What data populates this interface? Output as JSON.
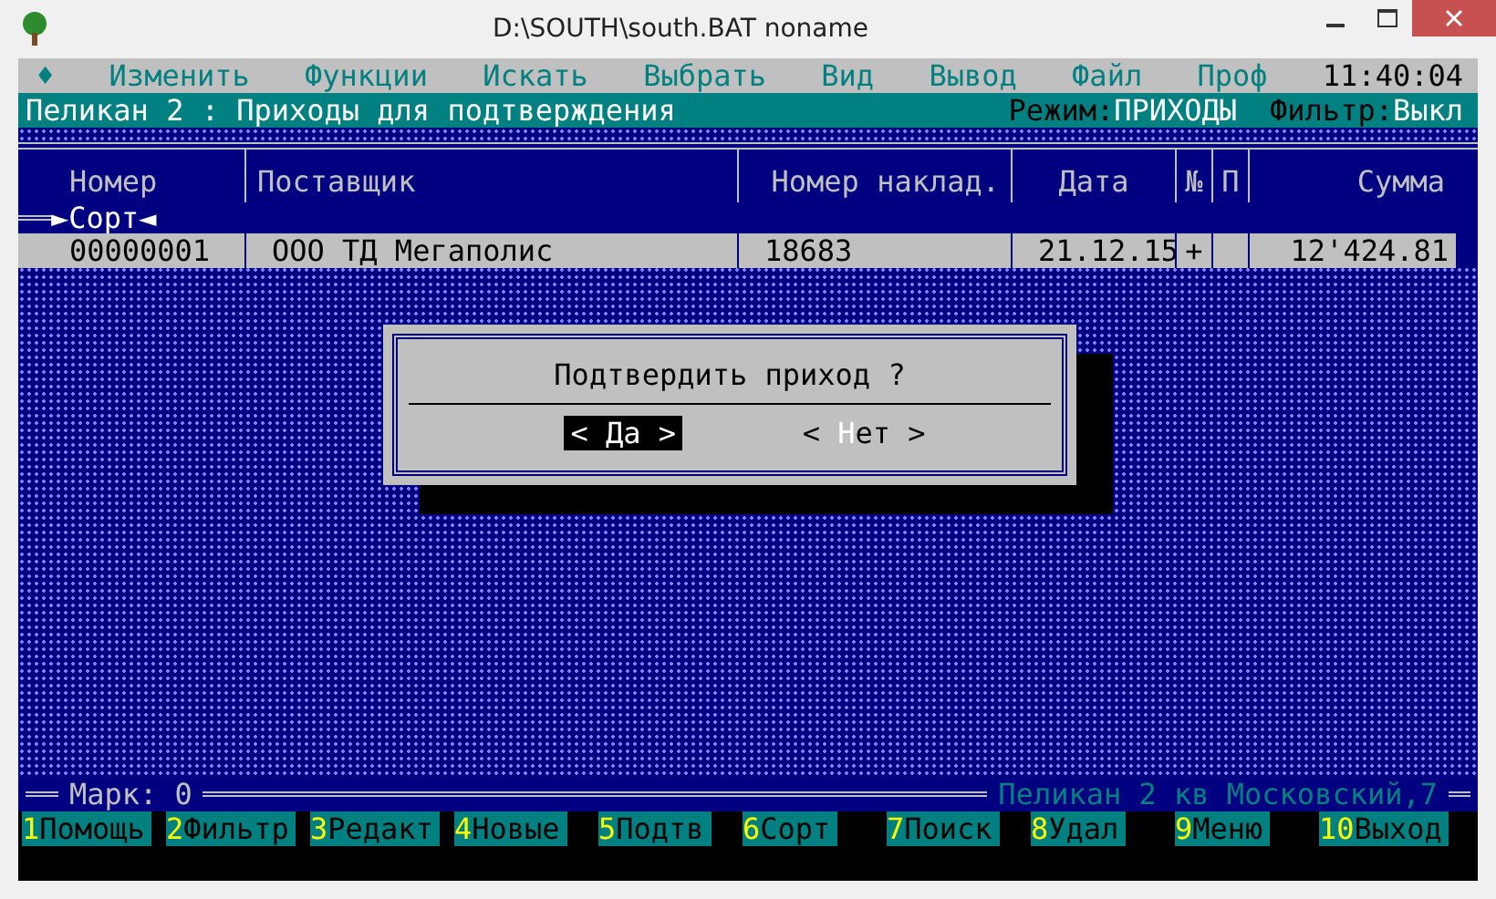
{
  "window": {
    "title": "D:\\SOUTH\\south.BAT noname"
  },
  "menu": {
    "marker": "♦",
    "items": [
      "Изменить",
      "Функции",
      "Искать",
      "Выбрать",
      "Вид",
      "Вывод",
      "Файл",
      "Проф"
    ],
    "clock": "11:40:04"
  },
  "status": {
    "title": "Пеликан 2 : Приходы для подтверждения",
    "mode_label": "Режим:",
    "mode": "ПРИХОДЫ",
    "filter_label": "Фильтр:",
    "filter": "Выкл"
  },
  "table": {
    "columns": [
      "Номер",
      "Поставщик",
      "Номер наклад.",
      "Дата",
      "№",
      "П",
      "Сумма"
    ],
    "sort_marker": "►Сорт◄",
    "rows": [
      {
        "cells": [
          "00000001",
          "ООО ТД Мегаполис",
          "18683",
          "21.12.15",
          "+",
          "",
          "12'424.81"
        ],
        "selected": true
      }
    ]
  },
  "dialog": {
    "question": "Подтвердить приход ?",
    "buttons": [
      {
        "open": "<",
        "label": "Да",
        "close": ">",
        "selected": true
      },
      {
        "open": "<",
        "label": "Нет",
        "close": ">",
        "selected": false
      }
    ]
  },
  "footer": {
    "mark": "Марк: 0",
    "info": "Пеликан 2 кв Московский,7"
  },
  "fkeys": [
    {
      "key": "1",
      "label": "Помощь"
    },
    {
      "key": "2",
      "label": "Фильтр"
    },
    {
      "key": "3",
      "label": "Редакт"
    },
    {
      "key": "4",
      "label": "Новые"
    },
    {
      "key": "5",
      "label": "Подтв"
    },
    {
      "key": "6",
      "label": "Сорт"
    },
    {
      "key": "7",
      "label": "Поиск"
    },
    {
      "key": "8",
      "label": "Удал"
    },
    {
      "key": "9",
      "label": "Меню"
    },
    {
      "key": "10",
      "label": "Выход"
    }
  ]
}
